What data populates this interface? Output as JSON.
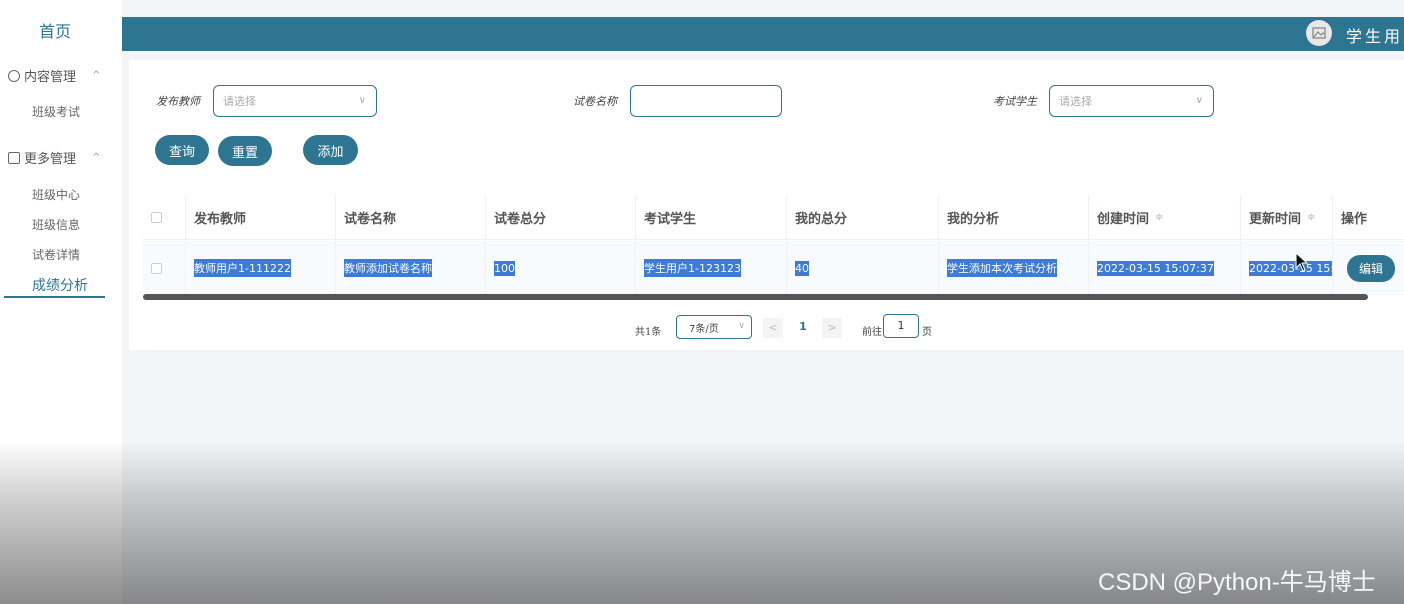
{
  "sidebar": {
    "home": "首页",
    "groups": [
      {
        "label": "内容管理",
        "items": [
          "班级考试"
        ]
      },
      {
        "label": "更多管理",
        "items": [
          "班级中心",
          "班级信息",
          "试卷详情",
          "成绩分析"
        ]
      }
    ],
    "active_item": "成绩分析"
  },
  "header": {
    "user_name": "学生用户",
    "bg_color": "#2e7592"
  },
  "filters": {
    "teacher_label": "发布教师",
    "teacher_placeholder": "请选择",
    "paper_name_label": "试卷名称",
    "paper_name_value": "",
    "student_label": "考试学生",
    "student_placeholder": "请选择"
  },
  "buttons": {
    "query": "查询",
    "reset": "重置",
    "add": "添加"
  },
  "table": {
    "columns": [
      "发布教师",
      "试卷名称",
      "试卷总分",
      "考试学生",
      "我的总分",
      "我的分析",
      "创建时间",
      "更新时间",
      "操作"
    ],
    "sortable_mark": "≑",
    "rows": [
      {
        "teacher": "教师用户1-111222",
        "paper_name": "教师添加试卷名称",
        "paper_total": "100",
        "student": "学生用户1-123123",
        "my_total": "40",
        "my_analysis": "学生添加本次考试分析",
        "created": "2022-03-15 15:07:37",
        "updated": "2022-03-15 15:",
        "action": "编辑"
      }
    ]
  },
  "pagination": {
    "total": "共1条",
    "page_size": "7条/页",
    "prev": "<",
    "next": ">",
    "current_page": "1",
    "goto_label": "前往",
    "goto_value": "1",
    "page_suffix": "页"
  },
  "watermark": "CSDN @Python-牛马博士",
  "accent_color": "#2e7592"
}
